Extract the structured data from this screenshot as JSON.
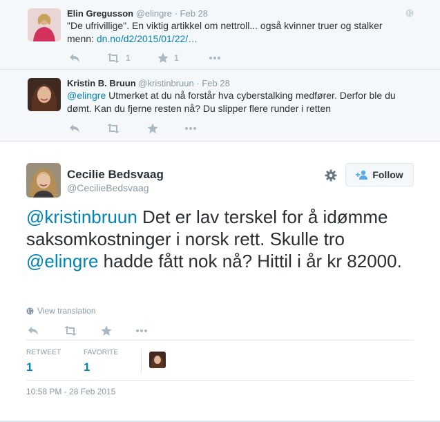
{
  "replies": [
    {
      "name": "Elin Gregusson",
      "handle": "@elingre",
      "separator": "·",
      "date": "Feb 28",
      "text_line1": "\"De ufrivillige\". En viktig artikkel om nettroll... også kvinner truer og stalker",
      "text_line2_prefix": "menn: ",
      "link": "dn.no/d2/2015/01/22/…",
      "retweet_count": "1",
      "favorite_count": "1",
      "icons": {
        "reply": "reply-icon",
        "retweet": "retweet-icon",
        "favorite": "star-icon",
        "more": "more-icon",
        "globe": "globe-icon"
      }
    },
    {
      "name": "Kristin B. Bruun",
      "handle": "@kristinbruun",
      "separator": "·",
      "date": "Feb 28",
      "mention": "@elingre",
      "text_line1_rest": " Utmerket at du nå forstår hva cyberstalking medfører. Derfor ble du",
      "text_line2": "dømt. Kan du fjerne resten nå? Du slipper flere runder i retten"
    }
  ],
  "main": {
    "name": "Cecilie Bedsvaag",
    "handle": "@CecilieBedsvaag",
    "follow_label": "Follow",
    "mention1": "@kristinbruun",
    "text_part1": " Det er lav terskel for å idømme saksomkostninger i norsk rett. Skulle tro ",
    "mention2": "@elingre",
    "text_part2": " hadde fått nok nå?  Hittil i år kr 82000.",
    "view_translation": "View translation",
    "retweets_label": "RETWEET",
    "retweets_value": "1",
    "favorites_label": "FAVORITE",
    "favorites_value": "1",
    "timestamp": "10:58 PM - 28 Feb 2015"
  },
  "colors": {
    "link": "#0084b4",
    "muted": "#8899a6",
    "icon": "#aab8c2",
    "text": "#292f33",
    "reply_bg": "#f5f8fa",
    "border": "#e1e8ed"
  }
}
